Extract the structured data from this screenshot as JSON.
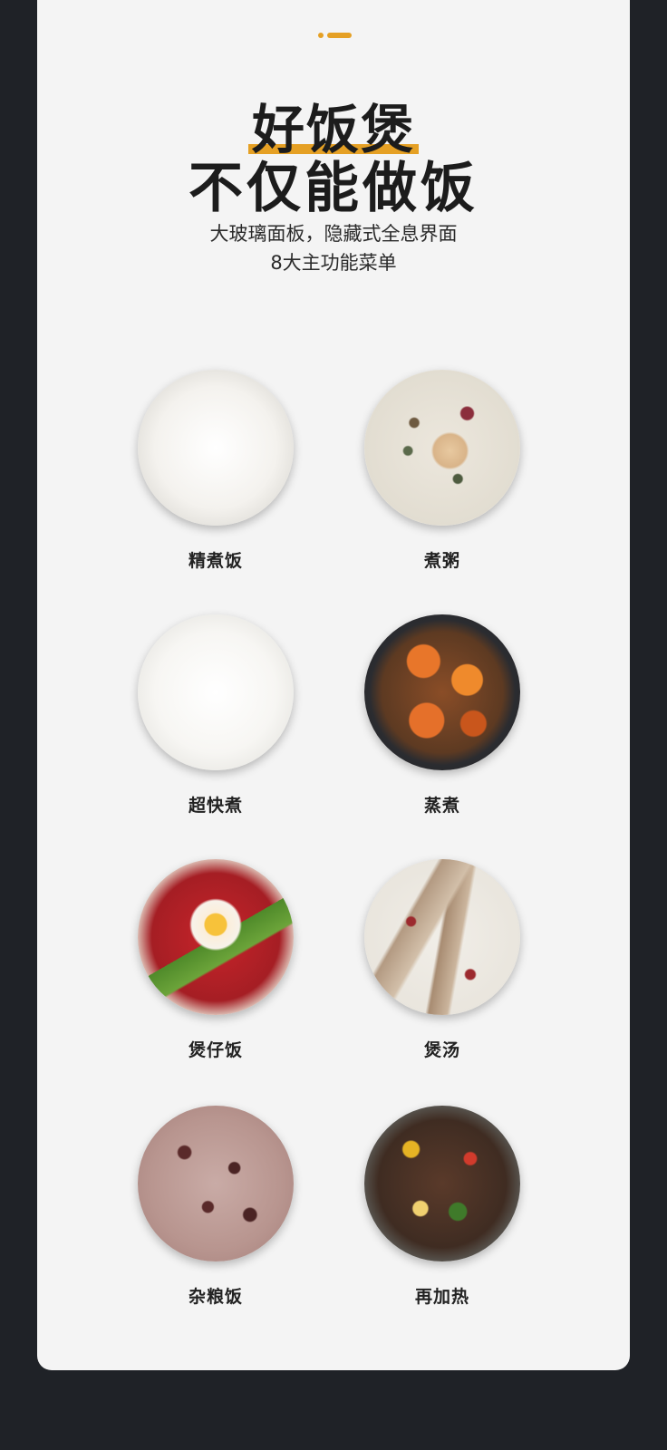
{
  "header": {
    "title_line1": "好饭煲",
    "title_line2": "不仅能做饭",
    "subtitle_line1": "大玻璃面板，隐藏式全息界面",
    "subtitle_line2": "8大主功能菜单"
  },
  "colors": {
    "accent": "#e5a024",
    "background": "#1f2227",
    "card": "#f4f4f4"
  },
  "menu_items": [
    {
      "label": "精煮饭",
      "icon": "rice-bowl-icon"
    },
    {
      "label": "煮粥",
      "icon": "porridge-bowl-icon"
    },
    {
      "label": "超快煮",
      "icon": "white-rice-bowl-icon"
    },
    {
      "label": "蒸煮",
      "icon": "steamed-crab-plate-icon"
    },
    {
      "label": "煲仔饭",
      "icon": "claypot-rice-icon"
    },
    {
      "label": "煲汤",
      "icon": "soup-bowl-icon"
    },
    {
      "label": "杂粮饭",
      "icon": "multigrain-rice-icon"
    },
    {
      "label": "再加热",
      "icon": "reheat-dish-icon"
    }
  ]
}
